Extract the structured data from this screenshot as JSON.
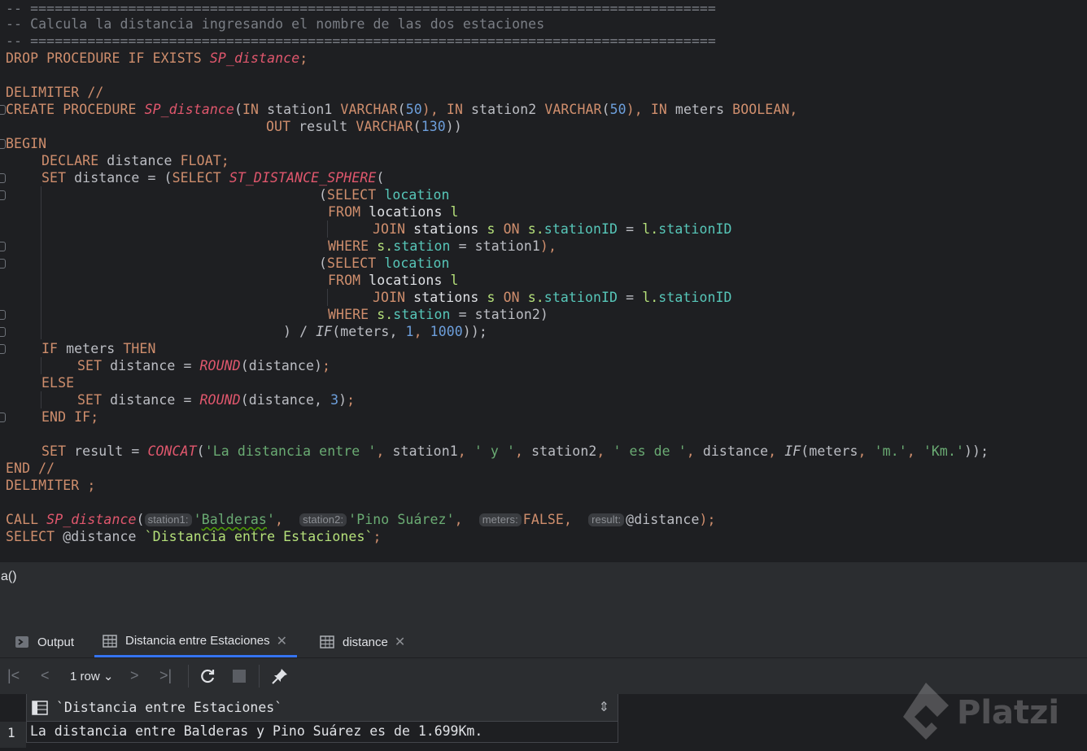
{
  "editor": {
    "code": {
      "l1": "-- ====================================================================================",
      "l2": "-- Calcula la distancia ingresando el nombre de las dos estaciones",
      "l3": "-- ====================================================================================",
      "drop_kw": "DROP PROCEDURE IF EXISTS ",
      "proc_name": "SP_distance",
      "semicolon": ";",
      "delimiter_line": "DELIMITER //",
      "create_kw": "CREATE PROCEDURE ",
      "create_params_a": "(",
      "in1": "IN",
      "p_station1": " station1 ",
      "varchar": "VARCHAR",
      "lp": "(",
      "n50": "50",
      "rp_comma": "), ",
      "in2": "IN",
      "p_station2": " station2 ",
      "in3": "IN",
      "p_meters": " meters ",
      "boolean": "BOOLEAN",
      "comma": ",",
      "out_kw": "OUT",
      "p_result": " result ",
      "n130": "130",
      "rpp": "))",
      "begin": "BEGIN",
      "declare_kw": "DECLARE",
      "declare_rest": " distance ",
      "float_kw": "FLOAT",
      "set_kw": "SET",
      "set_distance_eq": " distance = (",
      "select_kw": "SELECT",
      "st_fn": "ST_DISTANCE_SPHERE",
      "open_paren": "(",
      "sub_open": "(",
      "location_col": "location",
      "from_kw": "FROM",
      "locations_tbl": " locations ",
      "alias_l": "l",
      "join_kw": "JOIN",
      "stations_tbl": " stations ",
      "alias_s": "s",
      "on_kw": "ON",
      "s_dot": "s.",
      "stationID": "stationID",
      "eq": " = ",
      "l_dot": "l.",
      "where_kw": "WHERE",
      "station_col": "station",
      "eq_station1": " = station1",
      "close_comma": "),",
      "eq_station2": " = station2",
      "close_paren": ")",
      "close_div": ") / ",
      "if_fn": "IF",
      "if_args_a": "(meters, ",
      "n1": "1",
      "n1000": "1000",
      "close_end": "));",
      "if_kw": "IF",
      "if_meters": " meters ",
      "then_kw": "THEN",
      "round_fn": "ROUND",
      "round_arg1": "(distance)",
      "else_kw": "ELSE",
      "round_arg2a": "(distance, ",
      "n3": "3",
      "end_if": "END IF;",
      "set_result": " result = ",
      "concat_fn": "CONCAT",
      "s1": "'La distancia entre '",
      "c_station1": " station1",
      "s2": "' y '",
      "c_station2": " station2",
      "s3": "' es de '",
      "c_distance": " distance",
      "c_meters": "(meters",
      "s4": "'m.'",
      "s5": "'Km.'",
      "end_delim": "END //",
      "delimiter_semicolon": "DELIMITER ;",
      "call_kw": "CALL ",
      "hint_station1": "station1:",
      "arg_balderas_q1": "'",
      "arg_balderas": "Balderas",
      "arg_balderas_q2": "'",
      "hint_station2": "station2:",
      "arg_pino": "'Pino Suárez'",
      "hint_meters": "meters:",
      "false_kw": "FALSE",
      "hint_result": "result:",
      "arg_var": "@distance",
      "close_semicolon": ");",
      "select_at": " @distance ",
      "alias_str": "`Distancia entre Estaciones`"
    }
  },
  "statusbar": {
    "text": "a()"
  },
  "tabs": [
    {
      "label": "Output"
    },
    {
      "label": "Distancia entre Estaciones",
      "close": "✕"
    },
    {
      "label": "distance",
      "close": "✕"
    }
  ],
  "toolbar": {
    "rows_label": "1 row"
  },
  "results": {
    "column_header": "`Distancia entre Estaciones`",
    "sort_icon": "⇕",
    "row_number": "1",
    "row_value": "La distancia entre Balderas y Pino Suárez es de 1.699Km."
  },
  "watermark": {
    "text": "Platzi"
  },
  "colors": {
    "keyword": "#cf8e6d",
    "function": "#e0576d",
    "number": "#6d9fdc",
    "string": "#6aab73",
    "accent": "#3574f0"
  }
}
